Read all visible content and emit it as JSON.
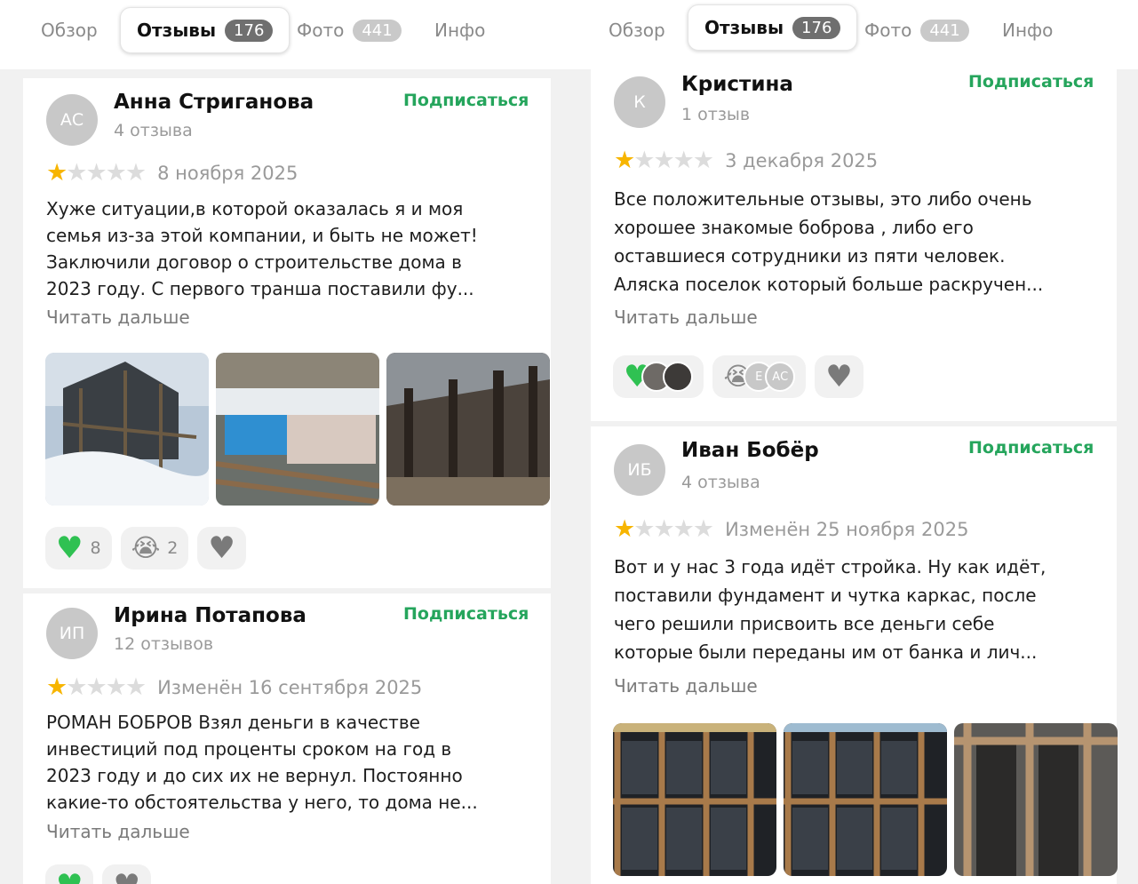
{
  "tabs": [
    {
      "label": "Обзор"
    },
    {
      "label": "Отзывы",
      "badge": "176"
    },
    {
      "label": "Фото",
      "badge": "441"
    },
    {
      "label": "Инфо"
    }
  ],
  "subscribe_label": "Подписаться",
  "read_more_label": "Читать дальше",
  "rating_stars": {
    "filled": 1,
    "max": 5
  },
  "colors": {
    "accent_green": "#25a55c",
    "star": "#f7b500",
    "heart_green": "#2fc152"
  },
  "left_reviews": [
    {
      "initials": "АС",
      "author": "Анна Стриганова",
      "count": "4 отзыва",
      "date": "8 ноября 2025",
      "lines": [
        "Хуже ситуации,в которой оказалась я и моя",
        "семья из-за этой компании, и быть не может!",
        "Заключили договор о строительстве дома в",
        "2023 году. С первого транша поставили фу..."
      ],
      "reactions": {
        "heart": "8",
        "cry": "2"
      }
    },
    {
      "initials": "ИП",
      "author": "Ирина Потапова",
      "count": "12 отзывов",
      "date": "Изменён 16 сентября 2025",
      "lines": [
        "РОМАН БОБРОВ Взял деньги в качестве",
        "инвестиций под проценты сроком на год в",
        "2023 году и до сих их не вернул. Постоянно",
        "какие-то обстоятельства у него, то дома не..."
      ]
    }
  ],
  "right_reviews": [
    {
      "initials": "К",
      "author": "Кристина",
      "count": "1 отзыв",
      "date": "3 декабря 2025",
      "lines": [
        "Все положительные отзывы, это либо очень",
        "хорошее знакомые боброва , либо его",
        "оставшиеся сотрудники из пяти человек.",
        "Аляска поселок который больше раскручен..."
      ],
      "reactor_initials": [
        "Е",
        "АС"
      ]
    },
    {
      "initials": "ИБ",
      "author": "Иван Бобёр",
      "count": "4 отзыва",
      "date": "Изменён 25 ноября 2025",
      "lines": [
        "Вот и у нас 3 года идёт стройка. Ну как идёт,",
        "поставили фундамент и чутка каркас, после",
        "чего решили присвоить все деньги себе",
        "которые были переданы им от банка и лич..."
      ]
    }
  ]
}
